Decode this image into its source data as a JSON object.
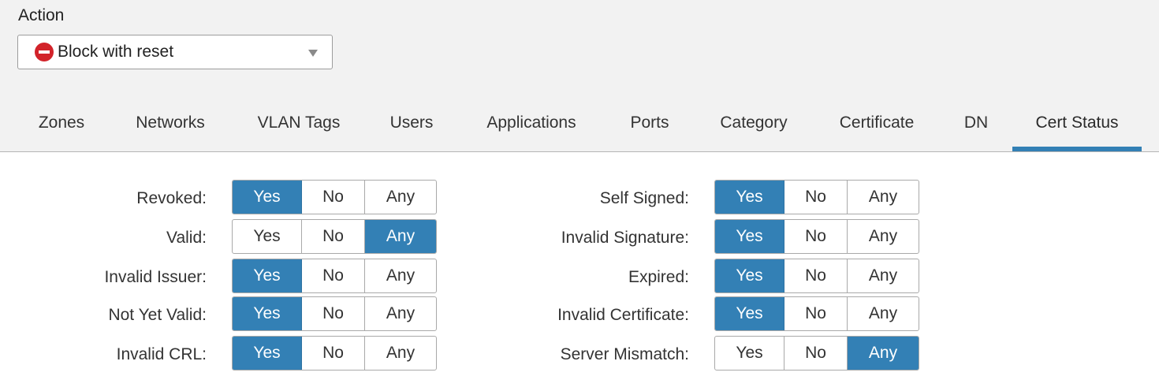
{
  "action": {
    "label": "Action",
    "selected": "Block with reset",
    "icon": "block-reset-icon",
    "icon_color": "#d2232a"
  },
  "tabs": [
    {
      "label": "Zones"
    },
    {
      "label": "Networks"
    },
    {
      "label": "VLAN Tags"
    },
    {
      "label": "Users"
    },
    {
      "label": "Applications"
    },
    {
      "label": "Ports"
    },
    {
      "label": "Category"
    },
    {
      "label": "Certificate"
    },
    {
      "label": "DN"
    },
    {
      "label": "Cert Status",
      "active": true
    }
  ],
  "accent_color": "#3380b5",
  "options": {
    "yes": "Yes",
    "no": "No",
    "any": "Any"
  },
  "left_rows": [
    {
      "label": "Revoked:",
      "value": "Yes"
    },
    {
      "label": "Valid:",
      "value": "Any"
    },
    {
      "label": "Invalid Issuer:",
      "value": "Yes"
    },
    {
      "label": "Not Yet Valid:",
      "value": "Yes"
    },
    {
      "label": "Invalid CRL:",
      "value": "Yes"
    }
  ],
  "right_rows": [
    {
      "label": "Self Signed:",
      "value": "Yes"
    },
    {
      "label": "Invalid Signature:",
      "value": "Yes"
    },
    {
      "label": "Expired:",
      "value": "Yes"
    },
    {
      "label": "Invalid Certificate:",
      "value": "Yes"
    },
    {
      "label": "Server Mismatch:",
      "value": "Any"
    }
  ]
}
